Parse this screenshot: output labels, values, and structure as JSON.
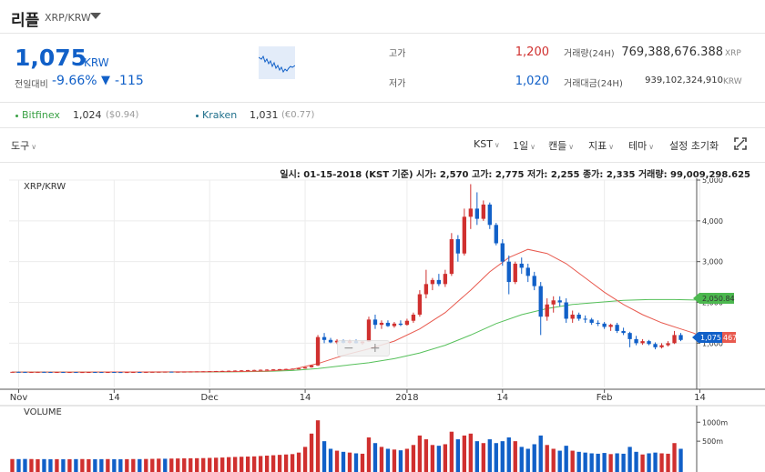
{
  "header": {
    "title": "리플",
    "pair": "XRP/KRW"
  },
  "summary": {
    "price": "1,075",
    "price_unit": "KRW",
    "change_label": "전일대비",
    "change_pct": "-9.66%",
    "change_arrow": "▼",
    "change_amount": "-115",
    "high_label": "고가",
    "high_value": "1,200",
    "low_label": "저가",
    "low_value": "1,020",
    "volume_label": "거래량(24H)",
    "volume_value": "769,388,676.388",
    "volume_unit": "XRP",
    "amount_label": "거래대금(24H)",
    "amount_value": "939,102,324,910",
    "amount_unit": "KRW"
  },
  "exchanges": [
    {
      "name": "Bitfinex",
      "price": "1,024",
      "sub": "($0.94)",
      "color": "#3aa145"
    },
    {
      "name": "Kraken",
      "price": "1,031",
      "sub": "(€0.77)",
      "color": "#1f6f8b"
    }
  ],
  "toolbar": {
    "tools": "도구",
    "timezone": "KST",
    "interval": "1일",
    "candle": "캔들",
    "indicator": "지표",
    "theme": "테마",
    "reset": "설정 초기화"
  },
  "ohlc_line": "일시: 01-15-2018 (KST 기준) 시가: 2,570 고가: 2,775 저가: 2,255 종가: 2,335 거래량: 99,009,298.625",
  "chart_labels": {
    "main_title": "XRP/KRW",
    "volume_title": "VOLUME",
    "ma1_tag": "2,050.84",
    "price_tag": "1,075",
    "price_tag_suffix": "467"
  },
  "chart_data": {
    "type": "candlestick",
    "y_ticks": [
      "5,000",
      "4,000",
      "3,000",
      "2,000",
      "1,000"
    ],
    "y_tick_values": [
      5000,
      4000,
      3000,
      2000,
      1000
    ],
    "ylim": [
      250,
      5000
    ],
    "x_ticks": [
      "Nov",
      "14",
      "Dec",
      "14",
      "2018",
      "14",
      "Feb",
      "14"
    ],
    "volume_ticks": [
      "1000m",
      "500m"
    ],
    "volume_tick_values": [
      1000,
      500
    ],
    "volume_ylim": [
      0,
      1150
    ],
    "up_color": "#d0302f",
    "down_color": "#1160c8",
    "ma_short_color": "#e85a4f",
    "ma_long_color": "#56c05a",
    "candles": [
      [
        295,
        300,
        292,
        298
      ],
      [
        298,
        302,
        294,
        296
      ],
      [
        296,
        300,
        291,
        293
      ],
      [
        293,
        297,
        289,
        295
      ],
      [
        295,
        299,
        292,
        297
      ],
      [
        297,
        301,
        293,
        294
      ],
      [
        294,
        298,
        290,
        292
      ],
      [
        292,
        296,
        288,
        294
      ],
      [
        294,
        297,
        290,
        291
      ],
      [
        291,
        295,
        288,
        293
      ],
      [
        293,
        296,
        289,
        290
      ],
      [
        290,
        294,
        287,
        292
      ],
      [
        292,
        295,
        289,
        294
      ],
      [
        294,
        298,
        291,
        293
      ],
      [
        293,
        296,
        289,
        291
      ],
      [
        291,
        295,
        288,
        294
      ],
      [
        294,
        298,
        291,
        292
      ],
      [
        292,
        296,
        289,
        290
      ],
      [
        290,
        294,
        287,
        292
      ],
      [
        292,
        296,
        289,
        295
      ],
      [
        295,
        299,
        292,
        293
      ],
      [
        293,
        297,
        290,
        296
      ],
      [
        296,
        300,
        293,
        298
      ],
      [
        298,
        303,
        295,
        300
      ],
      [
        300,
        305,
        297,
        302
      ],
      [
        302,
        306,
        298,
        299
      ],
      [
        299,
        303,
        296,
        301
      ],
      [
        301,
        305,
        298,
        303
      ],
      [
        303,
        308,
        300,
        305
      ],
      [
        305,
        310,
        302,
        307
      ],
      [
        307,
        312,
        304,
        309
      ],
      [
        309,
        316,
        306,
        312
      ],
      [
        312,
        320,
        308,
        316
      ],
      [
        316,
        325,
        312,
        320
      ],
      [
        320,
        330,
        316,
        324
      ],
      [
        324,
        335,
        320,
        328
      ],
      [
        328,
        340,
        324,
        333
      ],
      [
        333,
        345,
        330,
        338
      ],
      [
        338,
        350,
        334,
        343
      ],
      [
        343,
        355,
        339,
        348
      ],
      [
        348,
        360,
        344,
        352
      ],
      [
        352,
        365,
        348,
        358
      ],
      [
        358,
        370,
        354,
        362
      ],
      [
        362,
        375,
        358,
        368
      ],
      [
        368,
        382,
        364,
        373
      ],
      [
        373,
        390,
        370,
        380
      ],
      [
        380,
        420,
        376,
        410
      ],
      [
        410,
        470,
        400,
        455
      ],
      [
        455,
        1200,
        440,
        1150
      ],
      [
        1150,
        1250,
        1000,
        1080
      ],
      [
        1080,
        1130,
        1000,
        1020
      ],
      [
        1020,
        1100,
        980,
        1060
      ],
      [
        1060,
        1090,
        990,
        1010
      ],
      [
        1010,
        1080,
        980,
        1050
      ],
      [
        1050,
        1090,
        990,
        1000
      ],
      [
        1000,
        1050,
        960,
        1040
      ],
      [
        1040,
        1650,
        1030,
        1580
      ],
      [
        1580,
        1700,
        1350,
        1450
      ],
      [
        1450,
        1560,
        1350,
        1500
      ],
      [
        1500,
        1560,
        1400,
        1420
      ],
      [
        1420,
        1520,
        1380,
        1480
      ],
      [
        1480,
        1560,
        1420,
        1450
      ],
      [
        1450,
        1600,
        1430,
        1550
      ],
      [
        1550,
        1750,
        1500,
        1700
      ],
      [
        1700,
        2300,
        1650,
        2200
      ],
      [
        2200,
        2800,
        2100,
        2450
      ],
      [
        2450,
        2600,
        2300,
        2550
      ],
      [
        2550,
        2700,
        2400,
        2450
      ],
      [
        2450,
        2800,
        2380,
        2700
      ],
      [
        2700,
        3700,
        2650,
        3550
      ],
      [
        3550,
        3650,
        3000,
        3200
      ],
      [
        3200,
        4300,
        3150,
        4100
      ],
      [
        4100,
        4900,
        3800,
        4300
      ],
      [
        4300,
        4700,
        3900,
        4050
      ],
      [
        4050,
        4500,
        4000,
        4400
      ],
      [
        4400,
        4450,
        3800,
        3900
      ],
      [
        3900,
        3950,
        3400,
        3450
      ],
      [
        3450,
        3550,
        2900,
        3000
      ],
      [
        3000,
        3150,
        2200,
        2500
      ],
      [
        2500,
        3000,
        2450,
        2950
      ],
      [
        2950,
        3100,
        2700,
        2850
      ],
      [
        2850,
        2950,
        2500,
        2650
      ],
      [
        2650,
        2750,
        2300,
        2400
      ],
      [
        2400,
        2500,
        1200,
        1650
      ],
      [
        1650,
        2100,
        1550,
        1950
      ],
      [
        1950,
        2150,
        1750,
        2050
      ],
      [
        2050,
        2150,
        1900,
        2000
      ],
      [
        2000,
        2100,
        1500,
        1600
      ],
      [
        1600,
        1800,
        1500,
        1700
      ],
      [
        1700,
        1750,
        1550,
        1600
      ],
      [
        1600,
        1680,
        1500,
        1580
      ],
      [
        1580,
        1620,
        1450,
        1500
      ],
      [
        1500,
        1560,
        1420,
        1480
      ],
      [
        1480,
        1520,
        1350,
        1400
      ],
      [
        1400,
        1480,
        1300,
        1450
      ],
      [
        1450,
        1500,
        1250,
        1300
      ],
      [
        1300,
        1380,
        1200,
        1250
      ],
      [
        1250,
        1280,
        900,
        1100
      ],
      [
        1100,
        1180,
        950,
        1000
      ],
      [
        1000,
        1100,
        960,
        1050
      ],
      [
        1050,
        1080,
        950,
        980
      ],
      [
        980,
        1020,
        850,
        900
      ],
      [
        900,
        1000,
        870,
        950
      ],
      [
        950,
        1050,
        920,
        1000
      ],
      [
        1000,
        1300,
        980,
        1200
      ],
      [
        1200,
        1250,
        1050,
        1080
      ]
    ],
    "volumes": [
      [
        30,
        0
      ],
      [
        28,
        1
      ],
      [
        32,
        1
      ],
      [
        30,
        0
      ],
      [
        26,
        0
      ],
      [
        28,
        1
      ],
      [
        25,
        1
      ],
      [
        27,
        0
      ],
      [
        24,
        1
      ],
      [
        26,
        0
      ],
      [
        28,
        1
      ],
      [
        30,
        0
      ],
      [
        26,
        0
      ],
      [
        25,
        1
      ],
      [
        27,
        1
      ],
      [
        29,
        0
      ],
      [
        26,
        1
      ],
      [
        24,
        1
      ],
      [
        27,
        0
      ],
      [
        30,
        0
      ],
      [
        28,
        1
      ],
      [
        32,
        0
      ],
      [
        35,
        0
      ],
      [
        40,
        0
      ],
      [
        38,
        1
      ],
      [
        42,
        0
      ],
      [
        45,
        0
      ],
      [
        48,
        0
      ],
      [
        50,
        0
      ],
      [
        52,
        0
      ],
      [
        55,
        0
      ],
      [
        60,
        0
      ],
      [
        65,
        0
      ],
      [
        70,
        0
      ],
      [
        80,
        0
      ],
      [
        85,
        0
      ],
      [
        90,
        0
      ],
      [
        95,
        0
      ],
      [
        100,
        0
      ],
      [
        110,
        0
      ],
      [
        120,
        0
      ],
      [
        130,
        0
      ],
      [
        140,
        0
      ],
      [
        150,
        0
      ],
      [
        160,
        0
      ],
      [
        200,
        0
      ],
      [
        350,
        0
      ],
      [
        700,
        0
      ],
      [
        1050,
        0
      ],
      [
        500,
        1
      ],
      [
        300,
        1
      ],
      [
        250,
        0
      ],
      [
        220,
        1
      ],
      [
        200,
        0
      ],
      [
        180,
        1
      ],
      [
        170,
        0
      ],
      [
        600,
        0
      ],
      [
        450,
        1
      ],
      [
        350,
        0
      ],
      [
        300,
        1
      ],
      [
        280,
        0
      ],
      [
        260,
        1
      ],
      [
        300,
        0
      ],
      [
        400,
        0
      ],
      [
        650,
        0
      ],
      [
        550,
        0
      ],
      [
        400,
        0
      ],
      [
        380,
        1
      ],
      [
        420,
        0
      ],
      [
        750,
        0
      ],
      [
        550,
        1
      ],
      [
        650,
        0
      ],
      [
        700,
        0
      ],
      [
        500,
        1
      ],
      [
        450,
        0
      ],
      [
        550,
        1
      ],
      [
        450,
        1
      ],
      [
        500,
        1
      ],
      [
        600,
        1
      ],
      [
        500,
        0
      ],
      [
        350,
        1
      ],
      [
        300,
        1
      ],
      [
        420,
        1
      ],
      [
        650,
        1
      ],
      [
        400,
        0
      ],
      [
        300,
        0
      ],
      [
        250,
        1
      ],
      [
        380,
        1
      ],
      [
        250,
        0
      ],
      [
        220,
        1
      ],
      [
        200,
        1
      ],
      [
        180,
        1
      ],
      [
        170,
        1
      ],
      [
        190,
        1
      ],
      [
        160,
        0
      ],
      [
        180,
        1
      ],
      [
        170,
        1
      ],
      [
        350,
        1
      ],
      [
        220,
        1
      ],
      [
        150,
        0
      ],
      [
        180,
        1
      ],
      [
        200,
        1
      ],
      [
        180,
        0
      ],
      [
        170,
        0
      ],
      [
        450,
        0
      ],
      [
        300,
        1
      ]
    ],
    "ma_short": [
      [
        0,
        292
      ],
      [
        10,
        292
      ],
      [
        20,
        294
      ],
      [
        30,
        298
      ],
      [
        36,
        305
      ],
      [
        40,
        318
      ],
      [
        44,
        360
      ],
      [
        48,
        500
      ],
      [
        52,
        700
      ],
      [
        56,
        860
      ],
      [
        60,
        1050
      ],
      [
        64,
        1350
      ],
      [
        68,
        1750
      ],
      [
        72,
        2300
      ],
      [
        75,
        2750
      ],
      [
        78,
        3100
      ],
      [
        81,
        3300
      ],
      [
        84,
        3200
      ],
      [
        87,
        2950
      ],
      [
        90,
        2600
      ],
      [
        93,
        2250
      ],
      [
        96,
        1950
      ],
      [
        99,
        1700
      ],
      [
        102,
        1500
      ],
      [
        105,
        1350
      ],
      [
        107,
        1250
      ],
      [
        109,
        1100
      ],
      [
        111,
        1070
      ]
    ],
    "ma_long": [
      [
        0,
        292
      ],
      [
        20,
        292
      ],
      [
        30,
        295
      ],
      [
        36,
        300
      ],
      [
        40,
        308
      ],
      [
        44,
        330
      ],
      [
        48,
        380
      ],
      [
        52,
        450
      ],
      [
        56,
        520
      ],
      [
        60,
        620
      ],
      [
        64,
        760
      ],
      [
        68,
        950
      ],
      [
        72,
        1200
      ],
      [
        76,
        1480
      ],
      [
        80,
        1700
      ],
      [
        84,
        1850
      ],
      [
        88,
        1950
      ],
      [
        92,
        2000
      ],
      [
        96,
        2050
      ],
      [
        100,
        2070
      ],
      [
        104,
        2070
      ],
      [
        111,
        2050
      ]
    ]
  }
}
